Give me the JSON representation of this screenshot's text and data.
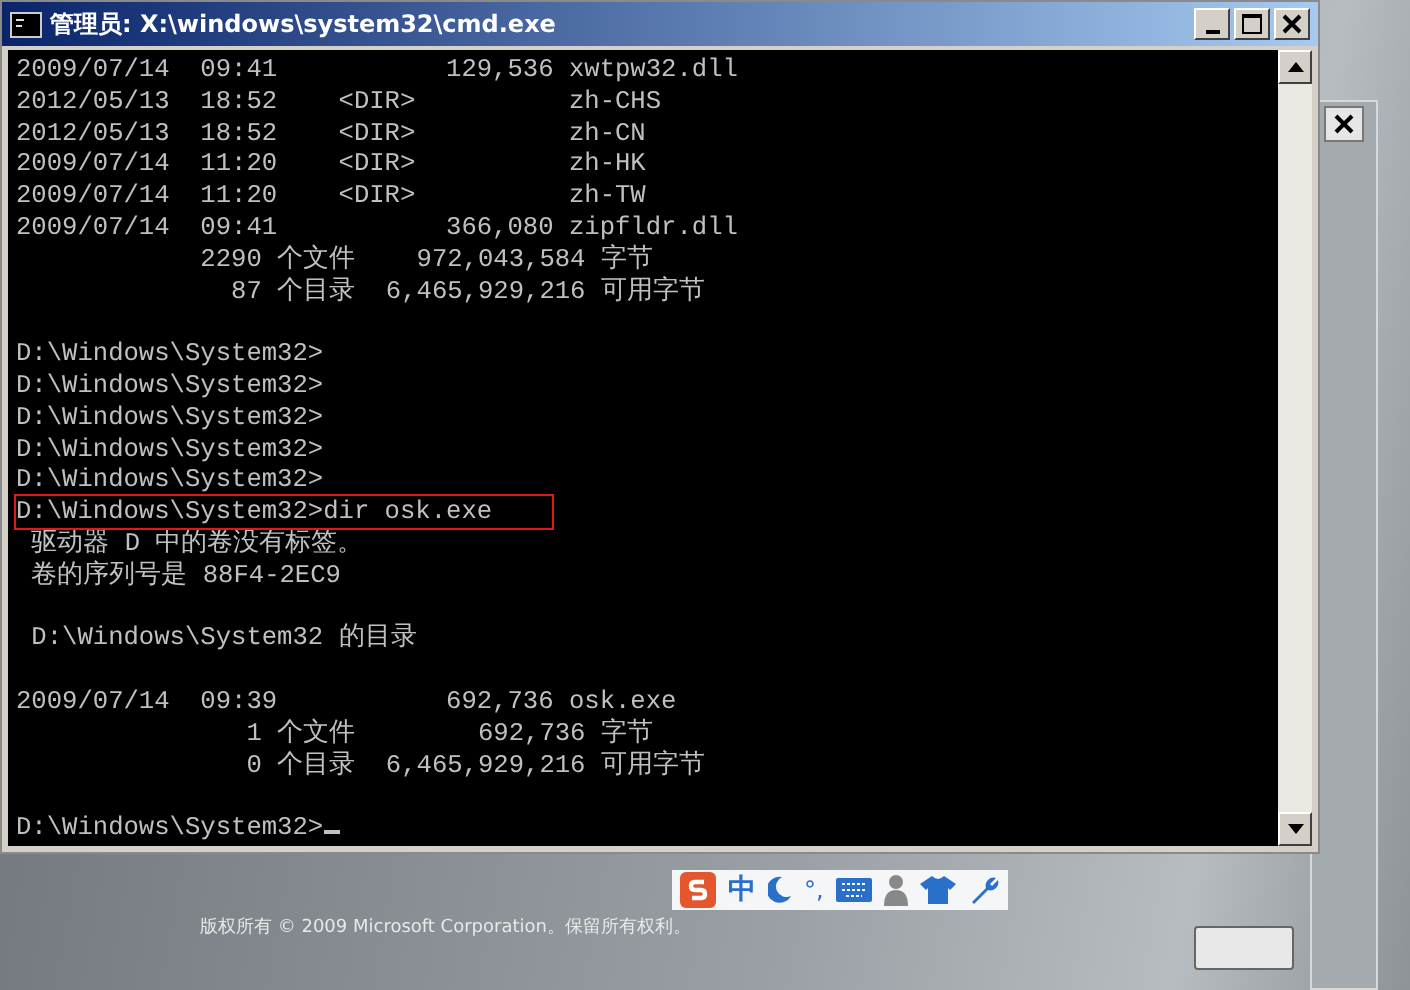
{
  "window": {
    "title": "管理员: X:\\windows\\system32\\cmd.exe"
  },
  "console": {
    "blocks": [
      {
        "lines": [
          {
            "text": "2009/07/14  09:41           129,536 xwtpw32.dll",
            "highlighted": false
          },
          {
            "text": "2012/05/13  18:52    <DIR>          zh-CHS",
            "highlighted": false
          },
          {
            "text": "2012/05/13  18:52    <DIR>          zh-CN",
            "highlighted": false
          },
          {
            "text": "2009/07/14  11:20    <DIR>          zh-HK",
            "highlighted": false
          },
          {
            "text": "2009/07/14  11:20    <DIR>          zh-TW",
            "highlighted": false
          },
          {
            "text": "2009/07/14  09:41           366,080 zipfldr.dll",
            "highlighted": false
          },
          {
            "text": "            2290 个文件    972,043,584 字节",
            "highlighted": false
          },
          {
            "text": "              87 个目录  6,465,929,216 可用字节",
            "highlighted": false
          }
        ]
      },
      {
        "lines": [
          {
            "text": "D:\\Windows\\System32>",
            "highlighted": false
          },
          {
            "text": "D:\\Windows\\System32>",
            "highlighted": false
          },
          {
            "text": "D:\\Windows\\System32>",
            "highlighted": false
          },
          {
            "text": "D:\\Windows\\System32>",
            "highlighted": false
          },
          {
            "text": "D:\\Windows\\System32>",
            "highlighted": false
          },
          {
            "text": "D:\\Windows\\System32>dir osk.exe",
            "highlighted": true
          },
          {
            "text": " 驱动器 D 中的卷没有标签。",
            "highlighted": false
          },
          {
            "text": " 卷的序列号是 88F4-2EC9",
            "highlighted": false
          }
        ]
      },
      {
        "lines": [
          {
            "text": " D:\\Windows\\System32 的目录",
            "highlighted": false
          }
        ]
      },
      {
        "lines": [
          {
            "text": "2009/07/14  09:39           692,736 osk.exe",
            "highlighted": false
          },
          {
            "text": "               1 个文件        692,736 字节",
            "highlighted": false
          },
          {
            "text": "               0 个目录  6,465,929,216 可用字节",
            "highlighted": false
          }
        ]
      },
      {
        "lines": [
          {
            "text": "D:\\Windows\\System32>",
            "highlighted": false,
            "cursor": true
          }
        ]
      }
    ]
  },
  "ime_toolbar": {
    "mode": "中",
    "punctuation": "°,"
  },
  "copyright": "版权所有 © 2009 Microsoft Corporation。保留所有权利。"
}
